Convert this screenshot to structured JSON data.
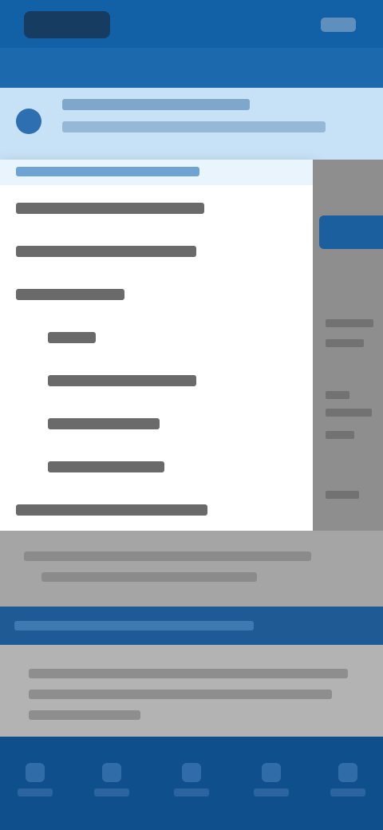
{
  "statusbar": {
    "logo_text": "",
    "icon_name": "network-icon"
  },
  "banner": {
    "icon": "info-icon",
    "line1": "",
    "line2": ""
  },
  "dropdown": {
    "header": "",
    "items": [
      {
        "label": "",
        "indent": false
      },
      {
        "label": "",
        "indent": false
      },
      {
        "label": "",
        "indent": false
      },
      {
        "label": "",
        "indent": true
      },
      {
        "label": "",
        "indent": true
      },
      {
        "label": "",
        "indent": true
      },
      {
        "label": "",
        "indent": true
      },
      {
        "label": "",
        "indent": false
      }
    ]
  },
  "right_pane": {
    "button_label": ""
  },
  "gray_card": {
    "line1": "",
    "line2": ""
  },
  "blue_strip": {
    "text": ""
  },
  "info_card": {
    "line1": "",
    "line2": "",
    "line3": ""
  },
  "bottom_nav": {
    "items": [
      {
        "icon": "home-icon",
        "label": ""
      },
      {
        "icon": "list-icon",
        "label": ""
      },
      {
        "icon": "grid-icon",
        "label": ""
      },
      {
        "icon": "user-icon",
        "label": ""
      },
      {
        "icon": "menu-icon",
        "label": ""
      }
    ]
  },
  "colors": {
    "primary": "#1260a6",
    "banner_bg": "#c7e2f6",
    "nav_bg": "#0f4f8c"
  }
}
